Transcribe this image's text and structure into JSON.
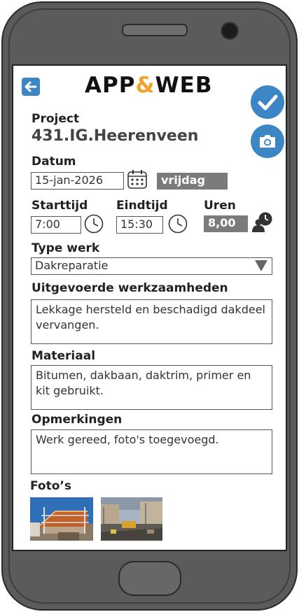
{
  "header": {
    "logo_left": "APP",
    "logo_amp": "&",
    "logo_right": "WEB"
  },
  "project": {
    "label": "Project",
    "value": "431.IG.Heerenveen"
  },
  "date": {
    "label": "Datum",
    "value": "15-jan-2026",
    "weekday": "vrijdag"
  },
  "time": {
    "start_label": "Starttijd",
    "start_value": "7:00",
    "end_label": "Eindtijd",
    "end_value": "15:30",
    "hours_label": "Uren",
    "hours_value": "8,00"
  },
  "work_type": {
    "label": "Type werk",
    "value": "Dakreparatie"
  },
  "work_done": {
    "label": "Uitgevoerde werkzaamheden",
    "value": "Lekkage hersteld en beschadigd dakdeel vervangen."
  },
  "material": {
    "label": "Materiaal",
    "value": "Bitumen, dakbaan, daktrim, primer en kit gebruikt."
  },
  "remarks": {
    "label": "Opmerkingen",
    "value": "Werk gereed, foto's toegevoegd."
  },
  "photos": {
    "label": "Foto’s"
  },
  "colors": {
    "accent": "#3d86c6",
    "logo_amp": "#f0a430",
    "field_grey": "#7b7b7b"
  },
  "icons": [
    "back-arrow-icon",
    "checkmark-icon",
    "camera-icon",
    "calendar-icon",
    "clock-icon",
    "user-clock-icon",
    "dropdown-triangle-icon"
  ]
}
